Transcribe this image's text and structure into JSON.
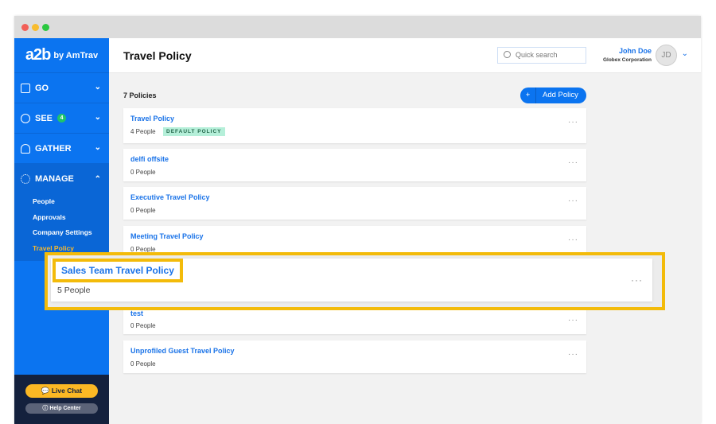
{
  "brand": {
    "logo": "a2b",
    "by": "by AmTrav"
  },
  "sidebar": {
    "items": [
      {
        "label": "GO",
        "icon": "briefcase-icon"
      },
      {
        "label": "SEE",
        "icon": "gauge-icon",
        "badge": "4"
      },
      {
        "label": "GATHER",
        "icon": "people-icon"
      },
      {
        "label": "MANAGE",
        "icon": "gear-icon"
      }
    ],
    "submenu": [
      "People",
      "Approvals",
      "Company Settings",
      "Travel Policy"
    ],
    "active": "Travel Policy",
    "live_chat": "Live Chat",
    "help_center": "Help Center"
  },
  "header": {
    "title": "Travel Policy",
    "search_placeholder": "Quick search",
    "user_name": "John Doe",
    "user_org": "Globex Corporation",
    "initials": "JD"
  },
  "main": {
    "count": "7 Policies",
    "add_button": "Add Policy",
    "add_plus": "+",
    "policies": [
      {
        "name": "Travel Policy",
        "people": "4 People",
        "badge": "DEFAULT POLICY"
      },
      {
        "name": "delfi offsite",
        "people": "0 People"
      },
      {
        "name": "Executive Travel Policy",
        "people": "0 People"
      },
      {
        "name": "Meeting Travel Policy",
        "people": "0 People"
      },
      {
        "name": "Sales Team Travel Policy",
        "people": "5 People"
      },
      {
        "name": "test",
        "people": "0 People"
      },
      {
        "name": "Unprofiled Guest Travel Policy",
        "people": "0 People"
      }
    ],
    "more": "···"
  },
  "colors": {
    "brand_blue": "#0b74f0",
    "highlight": "#f3bb0a",
    "active_link": "#f5b82e"
  }
}
